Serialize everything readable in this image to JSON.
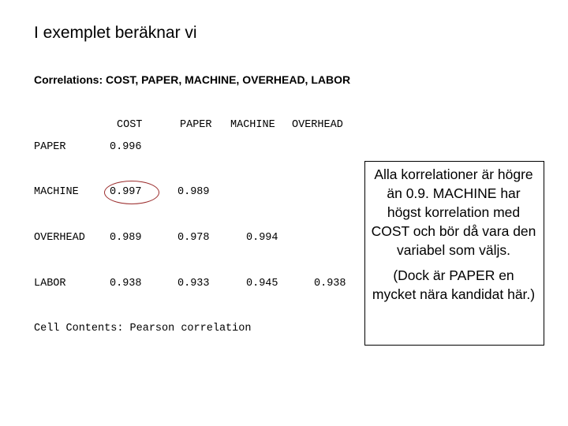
{
  "slide": {
    "title": "I exemplet beräknar vi",
    "subtitle": "Correlations: COST, PAPER, MACHINE, OVERHEAD, LABOR"
  },
  "correlation_table": {
    "column_headers": [
      "COST",
      "PAPER",
      "MACHINE",
      "OVERHEAD"
    ],
    "rows": [
      {
        "label": "PAPER",
        "values": [
          "0.996",
          "",
          "",
          ""
        ]
      },
      {
        "label": "MACHINE",
        "values": [
          "0.997",
          "0.989",
          "",
          ""
        ]
      },
      {
        "label": "OVERHEAD",
        "values": [
          "0.989",
          "0.978",
          "0.994",
          ""
        ]
      },
      {
        "label": "LABOR",
        "values": [
          "0.938",
          "0.933",
          "0.945",
          "0.938"
        ]
      }
    ],
    "footer": "Cell Contents: Pearson correlation",
    "highlighted_cell": {
      "row": "MACHINE",
      "column": "COST",
      "color": "#9b2c2c"
    }
  },
  "note_box": {
    "paragraph_1": "Alla korrelationer är högre än 0.9. MACHINE har högst korrelation med COST och bör då vara den variabel som väljs.",
    "paragraph_2": "(Dock är PAPER en mycket nära kandidat här.)"
  }
}
